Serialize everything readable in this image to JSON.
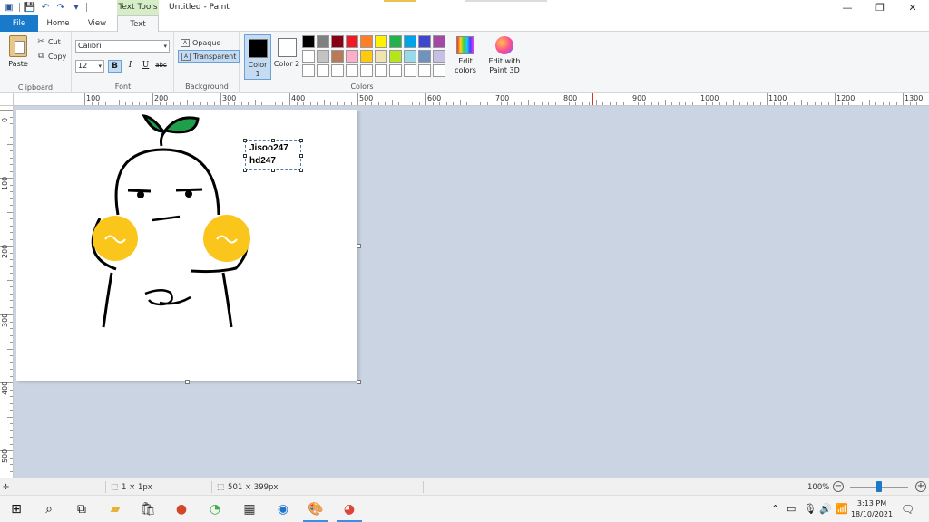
{
  "window": {
    "title": "Untitled - Paint",
    "contextual_tab": "Text Tools"
  },
  "tabs": [
    "File",
    "Home",
    "View",
    "Text"
  ],
  "clipboard": {
    "paste_label": "Paste",
    "cut_label": "Cut",
    "copy_label": "Copy",
    "group_label": "Clipboard"
  },
  "font": {
    "family": "Calibri",
    "size": "12",
    "bold_label": "B",
    "italic_label": "I",
    "underline_label": "U",
    "strike_label": "abc",
    "group_label": "Font"
  },
  "background": {
    "opaque_label": "Opaque",
    "transparent_label": "Transparent",
    "group_label": "Background"
  },
  "colors": {
    "color1_label": "Color 1",
    "color2_label": "Color 2",
    "color1_value": "#000000",
    "color2_value": "#ffffff",
    "palette": [
      "#000000",
      "#7f7f7f",
      "#880015",
      "#ed1c24",
      "#ff7f27",
      "#fff200",
      "#22b14c",
      "#00a2e8",
      "#3f48cc",
      "#a349a4",
      "#ffffff",
      "#c3c3c3",
      "#b97a57",
      "#ffaec9",
      "#ffc90e",
      "#efe4b0",
      "#b5e61d",
      "#99d9ea",
      "#7092be",
      "#c8bfe7",
      "#ffffff",
      "#ffffff",
      "#ffffff",
      "#ffffff",
      "#ffffff",
      "#ffffff",
      "#ffffff",
      "#ffffff",
      "#ffffff",
      "#ffffff"
    ],
    "edit_colors_label": "Edit colors",
    "edit_paint3d_label": "Edit with Paint 3D",
    "group_label": "Colors"
  },
  "ruler": {
    "h_ticks": [
      "100",
      "200",
      "300",
      "400",
      "500",
      "600",
      "700",
      "800",
      "900",
      "1000",
      "1100",
      "1200",
      "1300"
    ],
    "v_ticks": [
      "0",
      "100",
      "200",
      "300",
      "400",
      "500"
    ]
  },
  "textbox": {
    "line1": "Jisoo247",
    "line2": "hd247"
  },
  "status": {
    "selection_size": "1 × 1px",
    "canvas_size": "501 × 399px",
    "zoom": "100%"
  },
  "taskbar": {
    "time": "3:13 PM",
    "date": "18/10/2021"
  }
}
